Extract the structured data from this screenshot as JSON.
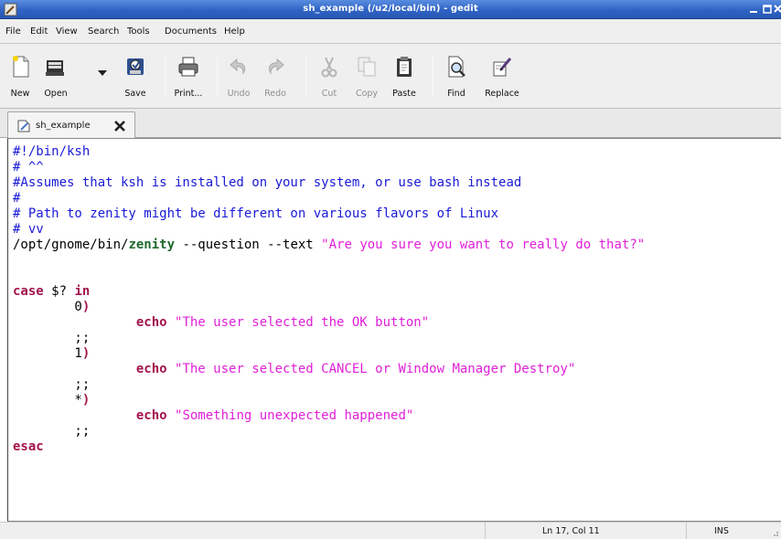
{
  "window": {
    "title": "sh_example (/u2/local/bin) - gedit",
    "title_bar_color": "#3566c9"
  },
  "menubar": {
    "items": [
      "File",
      "Edit",
      "View",
      "Search",
      "Tools",
      "Documents",
      "Help"
    ]
  },
  "toolbar": {
    "new_label": "New",
    "open_label": "Open",
    "save_label": "Save",
    "print_label": "Print...",
    "undo_label": "Undo",
    "redo_label": "Redo",
    "cut_label": "Cut",
    "copy_label": "Copy",
    "paste_label": "Paste",
    "find_label": "Find",
    "replace_label": "Replace",
    "icons": [
      "new-document-icon",
      "open-folder-icon",
      "dropdown-arrow-icon",
      "save-icon",
      "print-icon",
      "undo-icon",
      "redo-icon",
      "cut-icon",
      "copy-icon",
      "paste-icon",
      "find-icon",
      "replace-icon"
    ],
    "disabled": [
      "Undo",
      "Redo",
      "Cut",
      "Copy"
    ]
  },
  "tabs": [
    {
      "label": "sh_example",
      "icon": "document-icon",
      "close_icon": "close-icon"
    }
  ],
  "editor": {
    "syntax_colors": {
      "comment": "#1a1ad6",
      "keyword": "#a3154d",
      "string": "#e020d8",
      "command": "#1e6a2e"
    },
    "lines": [
      [
        {
          "t": "#!/bin/ksh",
          "c": "c"
        }
      ],
      [
        {
          "t": "# ^^",
          "c": "c"
        }
      ],
      [
        {
          "t": "#Assumes that ksh is installed on your system, or use bash instead",
          "c": "c"
        }
      ],
      [
        {
          "t": "#",
          "c": "c"
        }
      ],
      [
        {
          "t": "# Path to zenity might be different on various flavors of Linux",
          "c": "c"
        }
      ],
      [
        {
          "t": "# vv",
          "c": "c"
        }
      ],
      [
        {
          "t": "/opt/gnome/bin/",
          "c": ""
        },
        {
          "t": "zenity",
          "c": "g"
        },
        {
          "t": " --question --text ",
          "c": ""
        },
        {
          "t": "\"Are you sure you want to really do that?\"",
          "c": "s"
        }
      ],
      [],
      [],
      [
        {
          "t": "case",
          "c": "k"
        },
        {
          "t": " $? ",
          "c": ""
        },
        {
          "t": "in",
          "c": "k"
        }
      ],
      [
        {
          "t": "        0",
          "c": ""
        },
        {
          "t": ")",
          "c": "k"
        }
      ],
      [
        {
          "t": "                echo",
          "c": "k"
        },
        {
          "t": " ",
          "c": ""
        },
        {
          "t": "\"The user selected the OK button\"",
          "c": "s"
        }
      ],
      [
        {
          "t": "        ;;",
          "c": ""
        }
      ],
      [
        {
          "t": "        1",
          "c": ""
        },
        {
          "t": ")",
          "c": "k"
        }
      ],
      [
        {
          "t": "                echo",
          "c": "k"
        },
        {
          "t": " ",
          "c": ""
        },
        {
          "t": "\"The user selected CANCEL or Window Manager Destroy\"",
          "c": "s"
        }
      ],
      [
        {
          "t": "        ;;",
          "c": ""
        }
      ],
      [
        {
          "t": "        *",
          "c": ""
        },
        {
          "t": ")",
          "c": "k"
        }
      ],
      [
        {
          "t": "                echo",
          "c": "k"
        },
        {
          "t": " ",
          "c": ""
        },
        {
          "t": "\"Something unexpected happened\"",
          "c": "s"
        }
      ],
      [
        {
          "t": "        ;;",
          "c": ""
        }
      ],
      [
        {
          "t": "esac",
          "c": "k"
        }
      ]
    ]
  },
  "statusbar": {
    "position": "Ln 17, Col 11",
    "mode": "INS"
  }
}
